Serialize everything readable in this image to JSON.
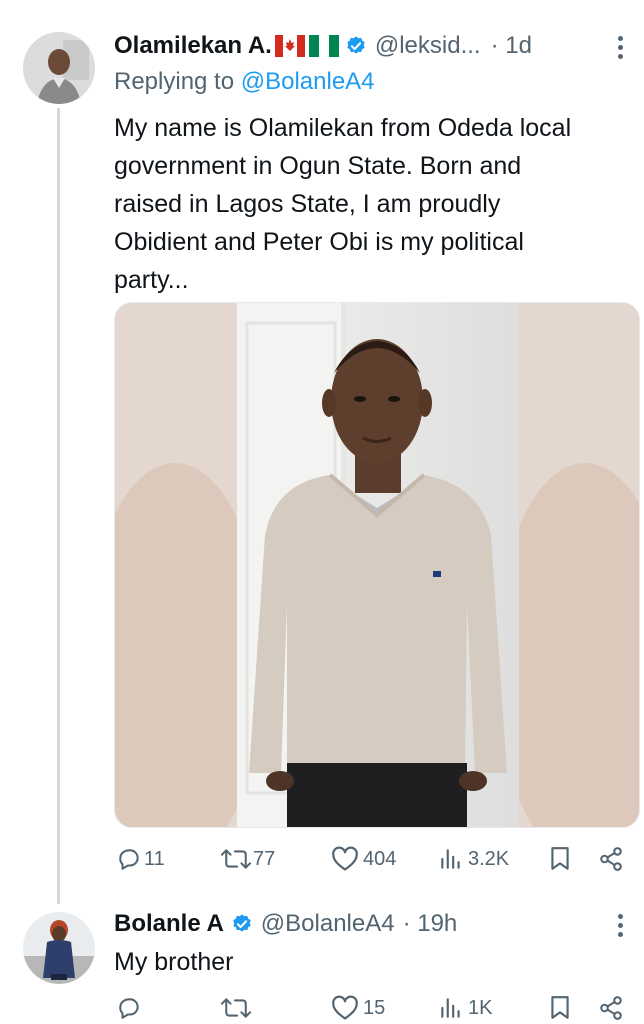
{
  "tweet1": {
    "author_name": "Olamilekan A.",
    "flags": "🇨🇦🇳🇬",
    "handle": "@leksid...",
    "time": "· 1d",
    "replying_prefix": "Replying to ",
    "replying_to": "@BolanleA4",
    "text_lines": [
      "My name is Olamilekan from Odeda local",
      "government in Ogun State. Born and",
      "raised in Lagos State, I am proudly",
      "Obidient and Peter Obi is my political",
      "party..."
    ],
    "actions": {
      "replies": "11",
      "retweets": "77",
      "likes": "404",
      "views": "3.2K"
    }
  },
  "tweet2": {
    "author_name": "Bolanle A",
    "handle": "@BolanleA4",
    "time": "· 19h",
    "text": "My brother",
    "actions": {
      "replies": "",
      "retweets": "",
      "likes": "15",
      "views": "1K"
    }
  },
  "colors": {
    "accent": "#1d9bf0",
    "secondary_text": "#536471",
    "primary_text": "#0f1419",
    "verified": "#1d9bf0"
  },
  "icons": [
    "reply-icon",
    "retweet-icon",
    "like-icon",
    "views-icon",
    "bookmark-icon",
    "share-icon",
    "more-icon",
    "verified-badge-icon"
  ]
}
